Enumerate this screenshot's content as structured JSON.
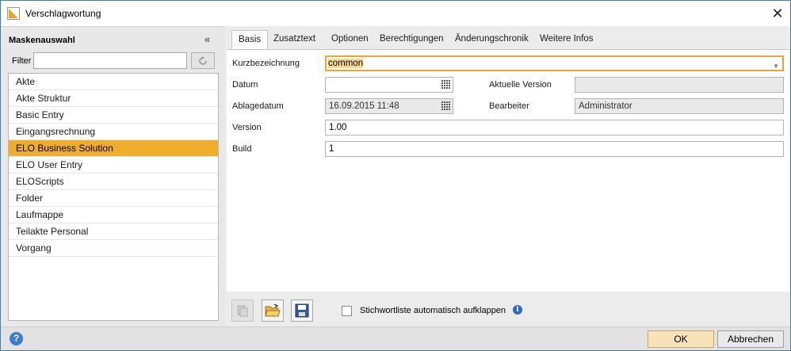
{
  "window": {
    "title": "Verschlagwortung",
    "close_label": "✕"
  },
  "sidebar": {
    "heading": "Maskenauswahl",
    "collapse_label": "«",
    "filter_label": "Filter",
    "filter_value": "",
    "items": [
      {
        "label": "Akte"
      },
      {
        "label": "Akte Struktur"
      },
      {
        "label": "Basic Entry"
      },
      {
        "label": "Eingangsrechnung"
      },
      {
        "label": "ELO Business Solution"
      },
      {
        "label": "ELO User Entry"
      },
      {
        "label": "ELOScripts"
      },
      {
        "label": "Folder"
      },
      {
        "label": "Laufmappe"
      },
      {
        "label": "Teilakte Personal"
      },
      {
        "label": "Vorgang"
      }
    ],
    "selected_index": 4
  },
  "tabs": [
    {
      "label": "Basis"
    },
    {
      "label": "Zusatztext"
    },
    {
      "label": "Optionen"
    },
    {
      "label": "Berechtigungen"
    },
    {
      "label": "Änderungschronik"
    },
    {
      "label": "Weitere Infos"
    }
  ],
  "form": {
    "kurzbezeichnung_label": "Kurzbezeichnung",
    "kurzbezeichnung_value": "common",
    "datum_label": "Datum",
    "datum_value": "",
    "aktuelle_version_label": "Aktuelle Version",
    "aktuelle_version_value": "",
    "ablagedatum_label": "Ablagedatum",
    "ablagedatum_value": "16.09.2015 11:48",
    "bearbeiter_label": "Bearbeiter",
    "bearbeiter_value": "Administrator",
    "version_label": "Version",
    "version_value": "1.00",
    "build_label": "Build",
    "build_value": "1"
  },
  "toolbar": {
    "auto_expand_label": "Stichwortliste automatisch aufklappen",
    "auto_expand_checked": false
  },
  "footer": {
    "ok_label": "OK",
    "cancel_label": "Abbrechen"
  },
  "colors": {
    "selection": "#f0ad2b",
    "focus_border": "#e9a73a",
    "ok_button": "#f8e3b9"
  }
}
